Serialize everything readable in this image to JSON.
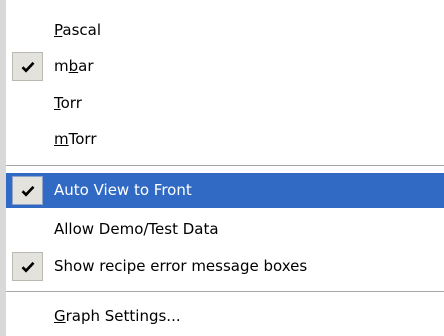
{
  "menu": {
    "items": [
      {
        "label": "Pascal",
        "mnemonic_prefix": "",
        "mnemonic_char": "P",
        "mnemonic_suffix": "ascal",
        "checked": false,
        "highlighted": false
      },
      {
        "label": "mbar",
        "mnemonic_prefix": "m",
        "mnemonic_char": "b",
        "mnemonic_suffix": "ar",
        "checked": true,
        "highlighted": false
      },
      {
        "label": "Torr",
        "mnemonic_prefix": "",
        "mnemonic_char": "T",
        "mnemonic_suffix": "orr",
        "checked": false,
        "highlighted": false
      },
      {
        "label": "mTorr",
        "mnemonic_prefix": "",
        "mnemonic_char": "m",
        "mnemonic_suffix": "Torr",
        "checked": false,
        "highlighted": false
      },
      {
        "label": "Auto View to Front",
        "checked": true,
        "highlighted": true
      },
      {
        "label": "Allow Demo/Test Data",
        "checked": false,
        "highlighted": false
      },
      {
        "label": "Show recipe error message boxes",
        "checked": true,
        "highlighted": false
      },
      {
        "label": "Graph Settings...",
        "mnemonic_prefix": "",
        "mnemonic_char": "G",
        "mnemonic_suffix": "raph Settings...",
        "checked": false,
        "highlighted": false
      }
    ],
    "colors": {
      "highlight": "#316ac5",
      "highlight_text": "#ffffff",
      "check_box_bg": "#e3e2dc",
      "separator": "#a6a6a6"
    },
    "icons": {
      "check": "checkmark-icon"
    }
  }
}
